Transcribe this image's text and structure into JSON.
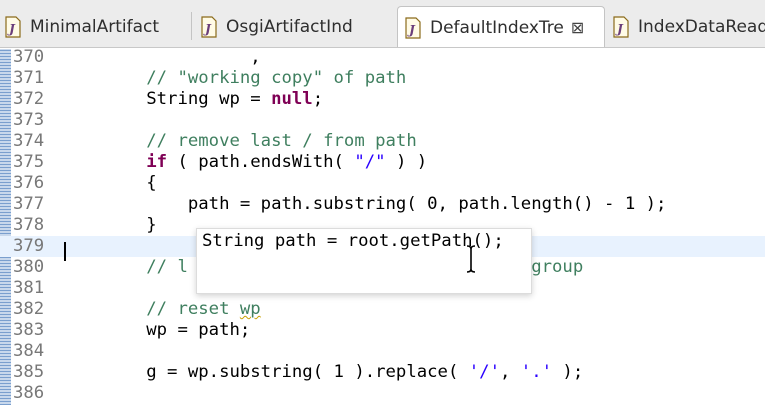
{
  "tabs": [
    {
      "label": "MinimalArtifact",
      "active": false,
      "icon": "java-file-icon"
    },
    {
      "label": "OsgiArtifactInd",
      "active": false,
      "icon": "java-file-icon"
    },
    {
      "label": "DefaultIndexTre",
      "active": true,
      "icon": "java-file-icon",
      "close_symbol": "⊠"
    },
    {
      "label": "IndexDataRead",
      "active": false,
      "icon": "java-file-icon"
    }
  ],
  "editor": {
    "current_line": "379",
    "lines": [
      {
        "n": "370",
        "parts": [
          [
            "plain",
            "                  ,"
          ]
        ]
      },
      {
        "n": "371",
        "parts": [
          [
            "cm",
            "        // \"working copy\" of path"
          ]
        ]
      },
      {
        "n": "372",
        "parts": [
          [
            "plain",
            "        String wp = "
          ],
          [
            "kw",
            "null"
          ],
          [
            "plain",
            ";"
          ]
        ]
      },
      {
        "n": "373",
        "parts": []
      },
      {
        "n": "374",
        "parts": [
          [
            "cm",
            "        // remove last / from path"
          ]
        ]
      },
      {
        "n": "375",
        "parts": [
          [
            "kw",
            "        if"
          ],
          [
            "plain",
            " ( path.endsWith( "
          ],
          [
            "str",
            "\"/\""
          ],
          [
            "plain",
            " ) )"
          ]
        ]
      },
      {
        "n": "376",
        "parts": [
          [
            "plain",
            "        {"
          ]
        ]
      },
      {
        "n": "377",
        "parts": [
          [
            "plain",
            "            path = path.substring( 0, path.length() - 1 );"
          ]
        ]
      },
      {
        "n": "378",
        "parts": [
          [
            "plain",
            "        }"
          ]
        ]
      },
      {
        "n": "379",
        "parts": []
      },
      {
        "n": "380",
        "parts": [
          [
            "cm",
            "        // l"
          ],
          [
            "plain",
            "                               "
          ],
          [
            "cm",
            "a group"
          ]
        ]
      },
      {
        "n": "381",
        "parts": []
      },
      {
        "n": "382",
        "parts": [
          [
            "cm",
            "        // reset "
          ],
          [
            "cmwarn",
            "wp"
          ]
        ]
      },
      {
        "n": "383",
        "parts": [
          [
            "plain",
            "        wp = path;"
          ]
        ]
      },
      {
        "n": "384",
        "parts": []
      },
      {
        "n": "385",
        "parts": [
          [
            "plain",
            "        g = wp.substring( 1 ).replace( "
          ],
          [
            "str",
            "'/'"
          ],
          [
            "plain",
            ", "
          ],
          [
            "str",
            "'.'"
          ],
          [
            "plain",
            " );"
          ]
        ]
      },
      {
        "n": "386",
        "parts": []
      }
    ]
  },
  "hover_popup": {
    "text": "String path = root.getPath();"
  },
  "colors": {
    "keyword": "#7f0055",
    "comment": "#3f7f5f",
    "string": "#2a00ff",
    "line_number": "#787878",
    "current_line_bg": "#e8f2fe",
    "change_bar": "#7a9fce"
  }
}
